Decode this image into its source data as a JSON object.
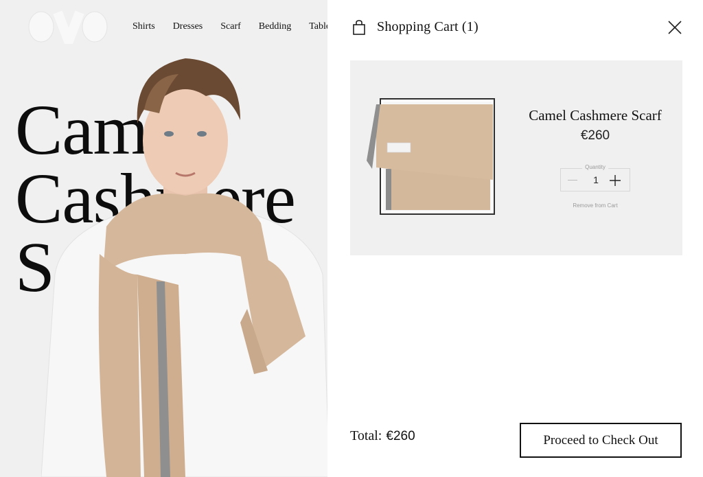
{
  "background_page": {
    "logo_icon": "ovo-logo",
    "nav": [
      "Shirts",
      "Dresses",
      "Scarf",
      "Bedding",
      "Table"
    ],
    "hero_title_lines": [
      "Camel",
      "Cashmere",
      "Scarf"
    ]
  },
  "cart": {
    "title": "Shopping Cart (1)",
    "bag_icon": "shopping-bag-icon",
    "close_icon": "close-icon",
    "item": {
      "name": "Camel Cashmere Scarf",
      "price": "€260",
      "quantity_label": "Quantity",
      "quantity": "1",
      "remove_label": "Remove from Cart"
    },
    "total_label": "Total:",
    "total_value": "€260",
    "checkout_label": "Proceed to Check Out"
  },
  "colors": {
    "drawer_bg": "#ffffff",
    "card_bg": "#f0f0f0",
    "text": "#111111",
    "scarf_camel": "#d5b79b",
    "scarf_grey": "#8f8f8f"
  }
}
